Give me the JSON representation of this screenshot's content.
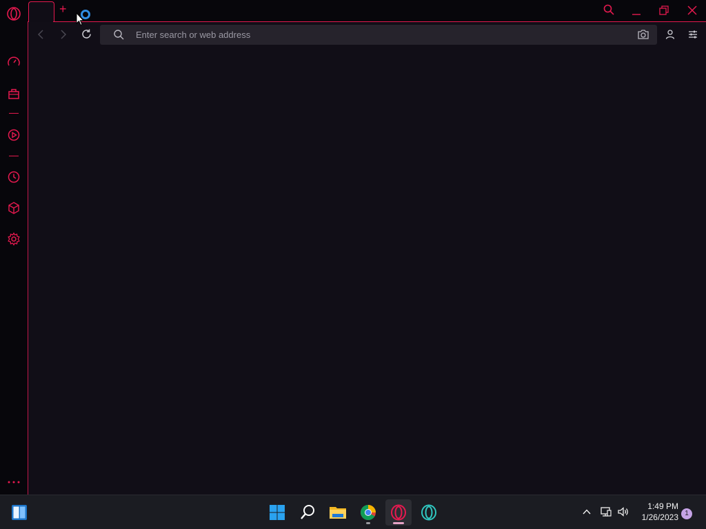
{
  "browser": {
    "address_bar": {
      "placeholder": "Enter search or web address",
      "value": ""
    },
    "new_tab_label": "+",
    "accent_color": "#e6194f",
    "sidebar_items": [
      {
        "name": "speed-dial",
        "icon": "speedometer-icon"
      },
      {
        "name": "my-flow",
        "icon": "bag-icon"
      },
      {
        "name": "player",
        "icon": "play-circle-icon"
      },
      {
        "name": "history",
        "icon": "clock-icon"
      },
      {
        "name": "extensions",
        "icon": "cube-icon"
      },
      {
        "name": "settings",
        "icon": "gear-icon"
      }
    ]
  },
  "taskbar": {
    "apps": [
      {
        "name": "start",
        "icon": "windows-logo-icon"
      },
      {
        "name": "search",
        "icon": "search-icon"
      },
      {
        "name": "file-explorer",
        "icon": "folder-icon"
      },
      {
        "name": "chrome",
        "icon": "chrome-icon"
      },
      {
        "name": "opera-gx",
        "icon": "opera-gx-icon"
      },
      {
        "name": "opera-teal",
        "icon": "opera-icon"
      }
    ],
    "clock": {
      "time": "1:49 PM",
      "date": "1/26/2023"
    },
    "notification_count": "1"
  }
}
